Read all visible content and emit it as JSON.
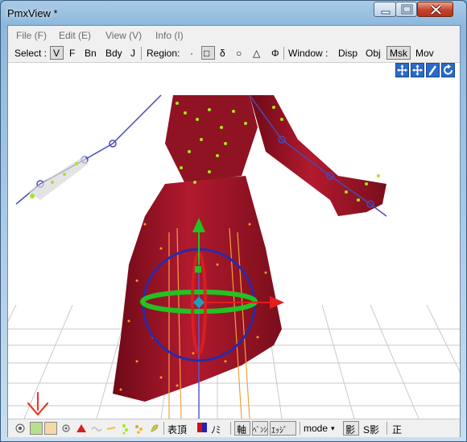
{
  "window": {
    "title": "PmxView *"
  },
  "menu": [
    {
      "label": "File (F)"
    },
    {
      "label": "Edit (E)"
    },
    {
      "label": "View (V)"
    },
    {
      "label": "Info (I)"
    }
  ],
  "toolbar": {
    "select_label": "Select :",
    "select_items": [
      "V",
      "F",
      "Bn",
      "Bdy",
      "J"
    ],
    "select_active": "V",
    "region_label": "Region:",
    "region_items": [
      "·",
      "□",
      "δ",
      "○",
      "△",
      "Φ"
    ],
    "window_label": "Window :",
    "window_items": [
      "Disp",
      "Obj",
      "Msk",
      "Mov"
    ],
    "window_active": "Msk"
  },
  "viewport": {
    "nav_icons": [
      "move-arrows-icon",
      "move-arrows-alt-icon",
      "pen-tool-icon",
      "rotate-icon"
    ]
  },
  "statusbar": {
    "morph_label": "表頂",
    "nomi_label": "ﾉﾐ",
    "axis_label": "軸",
    "bone_label": "ﾍﾞﾝｼ",
    "edge_label": "ｴｯｼﾞ",
    "mode_label": "mode",
    "shadow_label": "影",
    "sshadow_label": "S影",
    "sei_label": "正"
  },
  "colors": {
    "accent_blue": "#2a69c9",
    "dress_red": "#9c1425",
    "vertex_green": "#a6e61f",
    "vertex_orange": "#f0a020",
    "bone_blue": "#3a3ab0",
    "gizmo_green": "#23c223",
    "gizmo_red": "#e02020",
    "annotation_red": "#e53e2e"
  }
}
